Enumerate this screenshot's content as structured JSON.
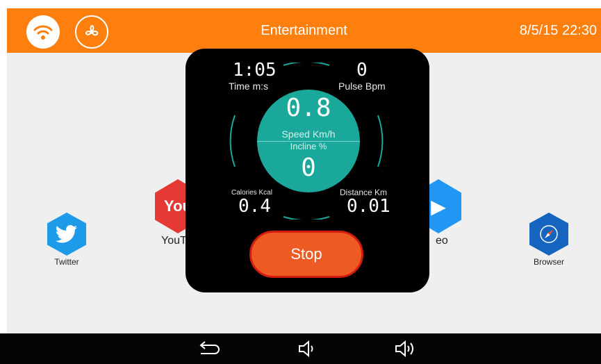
{
  "header": {
    "title": "Entertainment",
    "clock": "8/5/15 22:30",
    "wifi_icon": "wifi-icon",
    "fan_icon": "fan-icon",
    "accent_color": "#ff7f0e"
  },
  "apps": [
    {
      "label": "Twitter",
      "icon": "twitter-icon"
    },
    {
      "label": "YouT",
      "icon": "youtube-icon"
    },
    {
      "label": "eo",
      "icon": "video-icon"
    },
    {
      "label": "Browser",
      "icon": "browser-icon"
    }
  ],
  "workout": {
    "time_value": "1:05",
    "time_label": "Time m:s",
    "pulse_value": "0",
    "pulse_label": "Pulse Bpm",
    "speed_value": "0.8",
    "speed_label": "Speed Km/h",
    "incline_label": "Incline %",
    "incline_value": "0",
    "calories_label": "Calories Kcal",
    "calories_value": "0.4",
    "distance_label": "Distance Km",
    "distance_value": "0.01",
    "stop_label": "Stop",
    "teal_color": "#19a89a",
    "stop_color": "#ee5a24"
  },
  "navbar": {
    "back_icon": "back-icon",
    "volume_down_icon": "volume-down-icon",
    "volume_up_icon": "volume-up-icon"
  }
}
